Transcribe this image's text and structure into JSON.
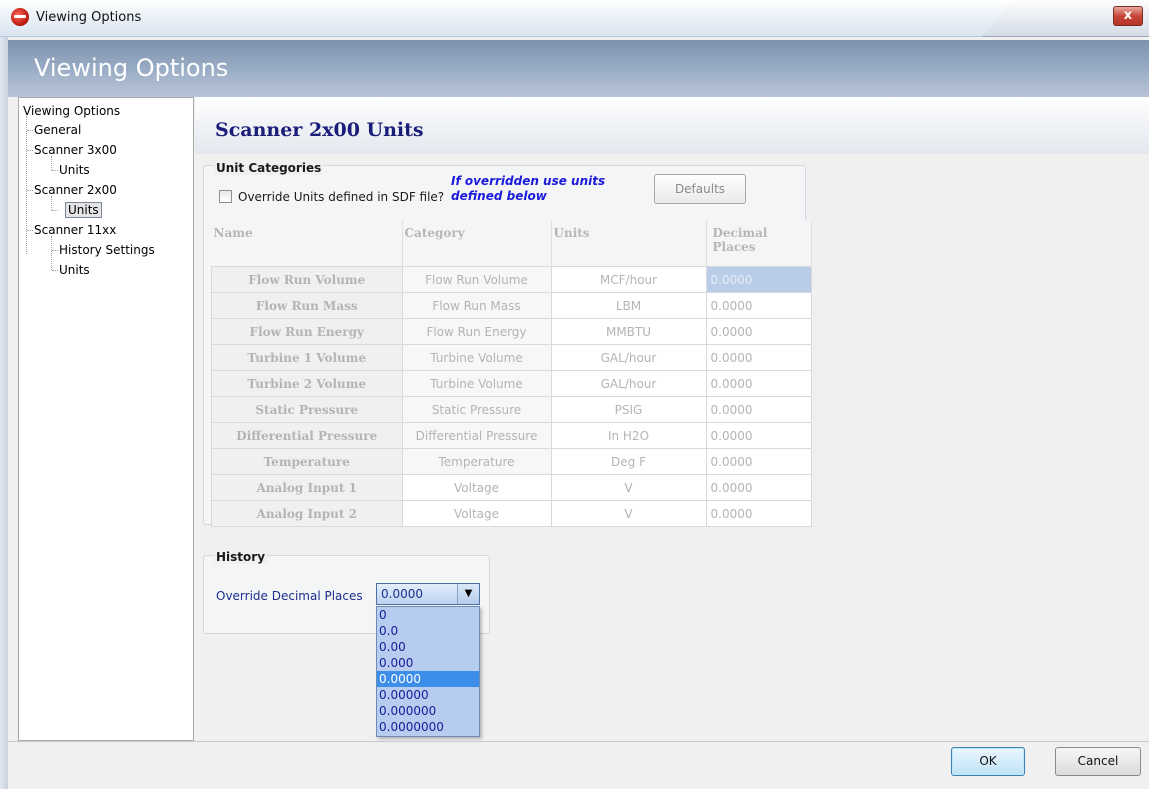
{
  "window": {
    "title": "Viewing Options",
    "close_glyph": "x"
  },
  "header": {
    "title": "Viewing Options"
  },
  "tree": {
    "root": "Viewing Options",
    "items": [
      {
        "label": "General"
      },
      {
        "label": "Scanner 3x00"
      },
      {
        "label": "Units"
      },
      {
        "label": "Scanner 2x00"
      },
      {
        "label": "Units"
      },
      {
        "label": "Scanner 11xx"
      },
      {
        "label": "History Settings"
      },
      {
        "label": "Units"
      }
    ],
    "selected_index": 4
  },
  "page": {
    "title": "Scanner 2x00 Units"
  },
  "unit_categories": {
    "legend": "Unit Categories",
    "override_label": "Override Units defined in SDF file?",
    "override_checked": false,
    "override_note": "If overridden use units defined below",
    "defaults_label": "Defaults",
    "columns": [
      "Name",
      "Category",
      "Units",
      "Decimal Places"
    ],
    "rows": [
      [
        "Flow Run Volume",
        "Flow Run Volume",
        "MCF/hour",
        "0.0000"
      ],
      [
        "Flow Run Mass",
        "Flow Run Mass",
        "LBM",
        "0.0000"
      ],
      [
        "Flow Run Energy",
        "Flow Run Energy",
        "MMBTU",
        "0.0000"
      ],
      [
        "Turbine 1 Volume",
        "Turbine Volume",
        "GAL/hour",
        "0.0000"
      ],
      [
        "Turbine 2 Volume",
        "Turbine Volume",
        "GAL/hour",
        "0.0000"
      ],
      [
        "Static Pressure",
        "Static Pressure",
        "PSIG",
        "0.0000"
      ],
      [
        "Differential Pressure",
        "Differential Pressure",
        "In H2O",
        "0.0000"
      ],
      [
        "Temperature",
        "Temperature",
        "Deg F",
        "0.0000"
      ],
      [
        "Analog Input 1",
        "Voltage",
        "V",
        "0.0000"
      ],
      [
        "Analog Input 2",
        "Voltage",
        "V",
        "0.0000"
      ]
    ]
  },
  "history": {
    "legend": "History",
    "label": "Override Decimal Places",
    "selected": "0.0000",
    "options": [
      "0",
      "0.0",
      "0.00",
      "0.000",
      "0.0000",
      "0.00000",
      "0.000000",
      "0.0000000"
    ],
    "highlighted_index": 4
  },
  "buttons": {
    "ok": "OK",
    "cancel": "Cancel"
  },
  "colors": {
    "accent": "#1b1e78",
    "note": "#1a1adb",
    "highlight": "#3d8ee9"
  }
}
